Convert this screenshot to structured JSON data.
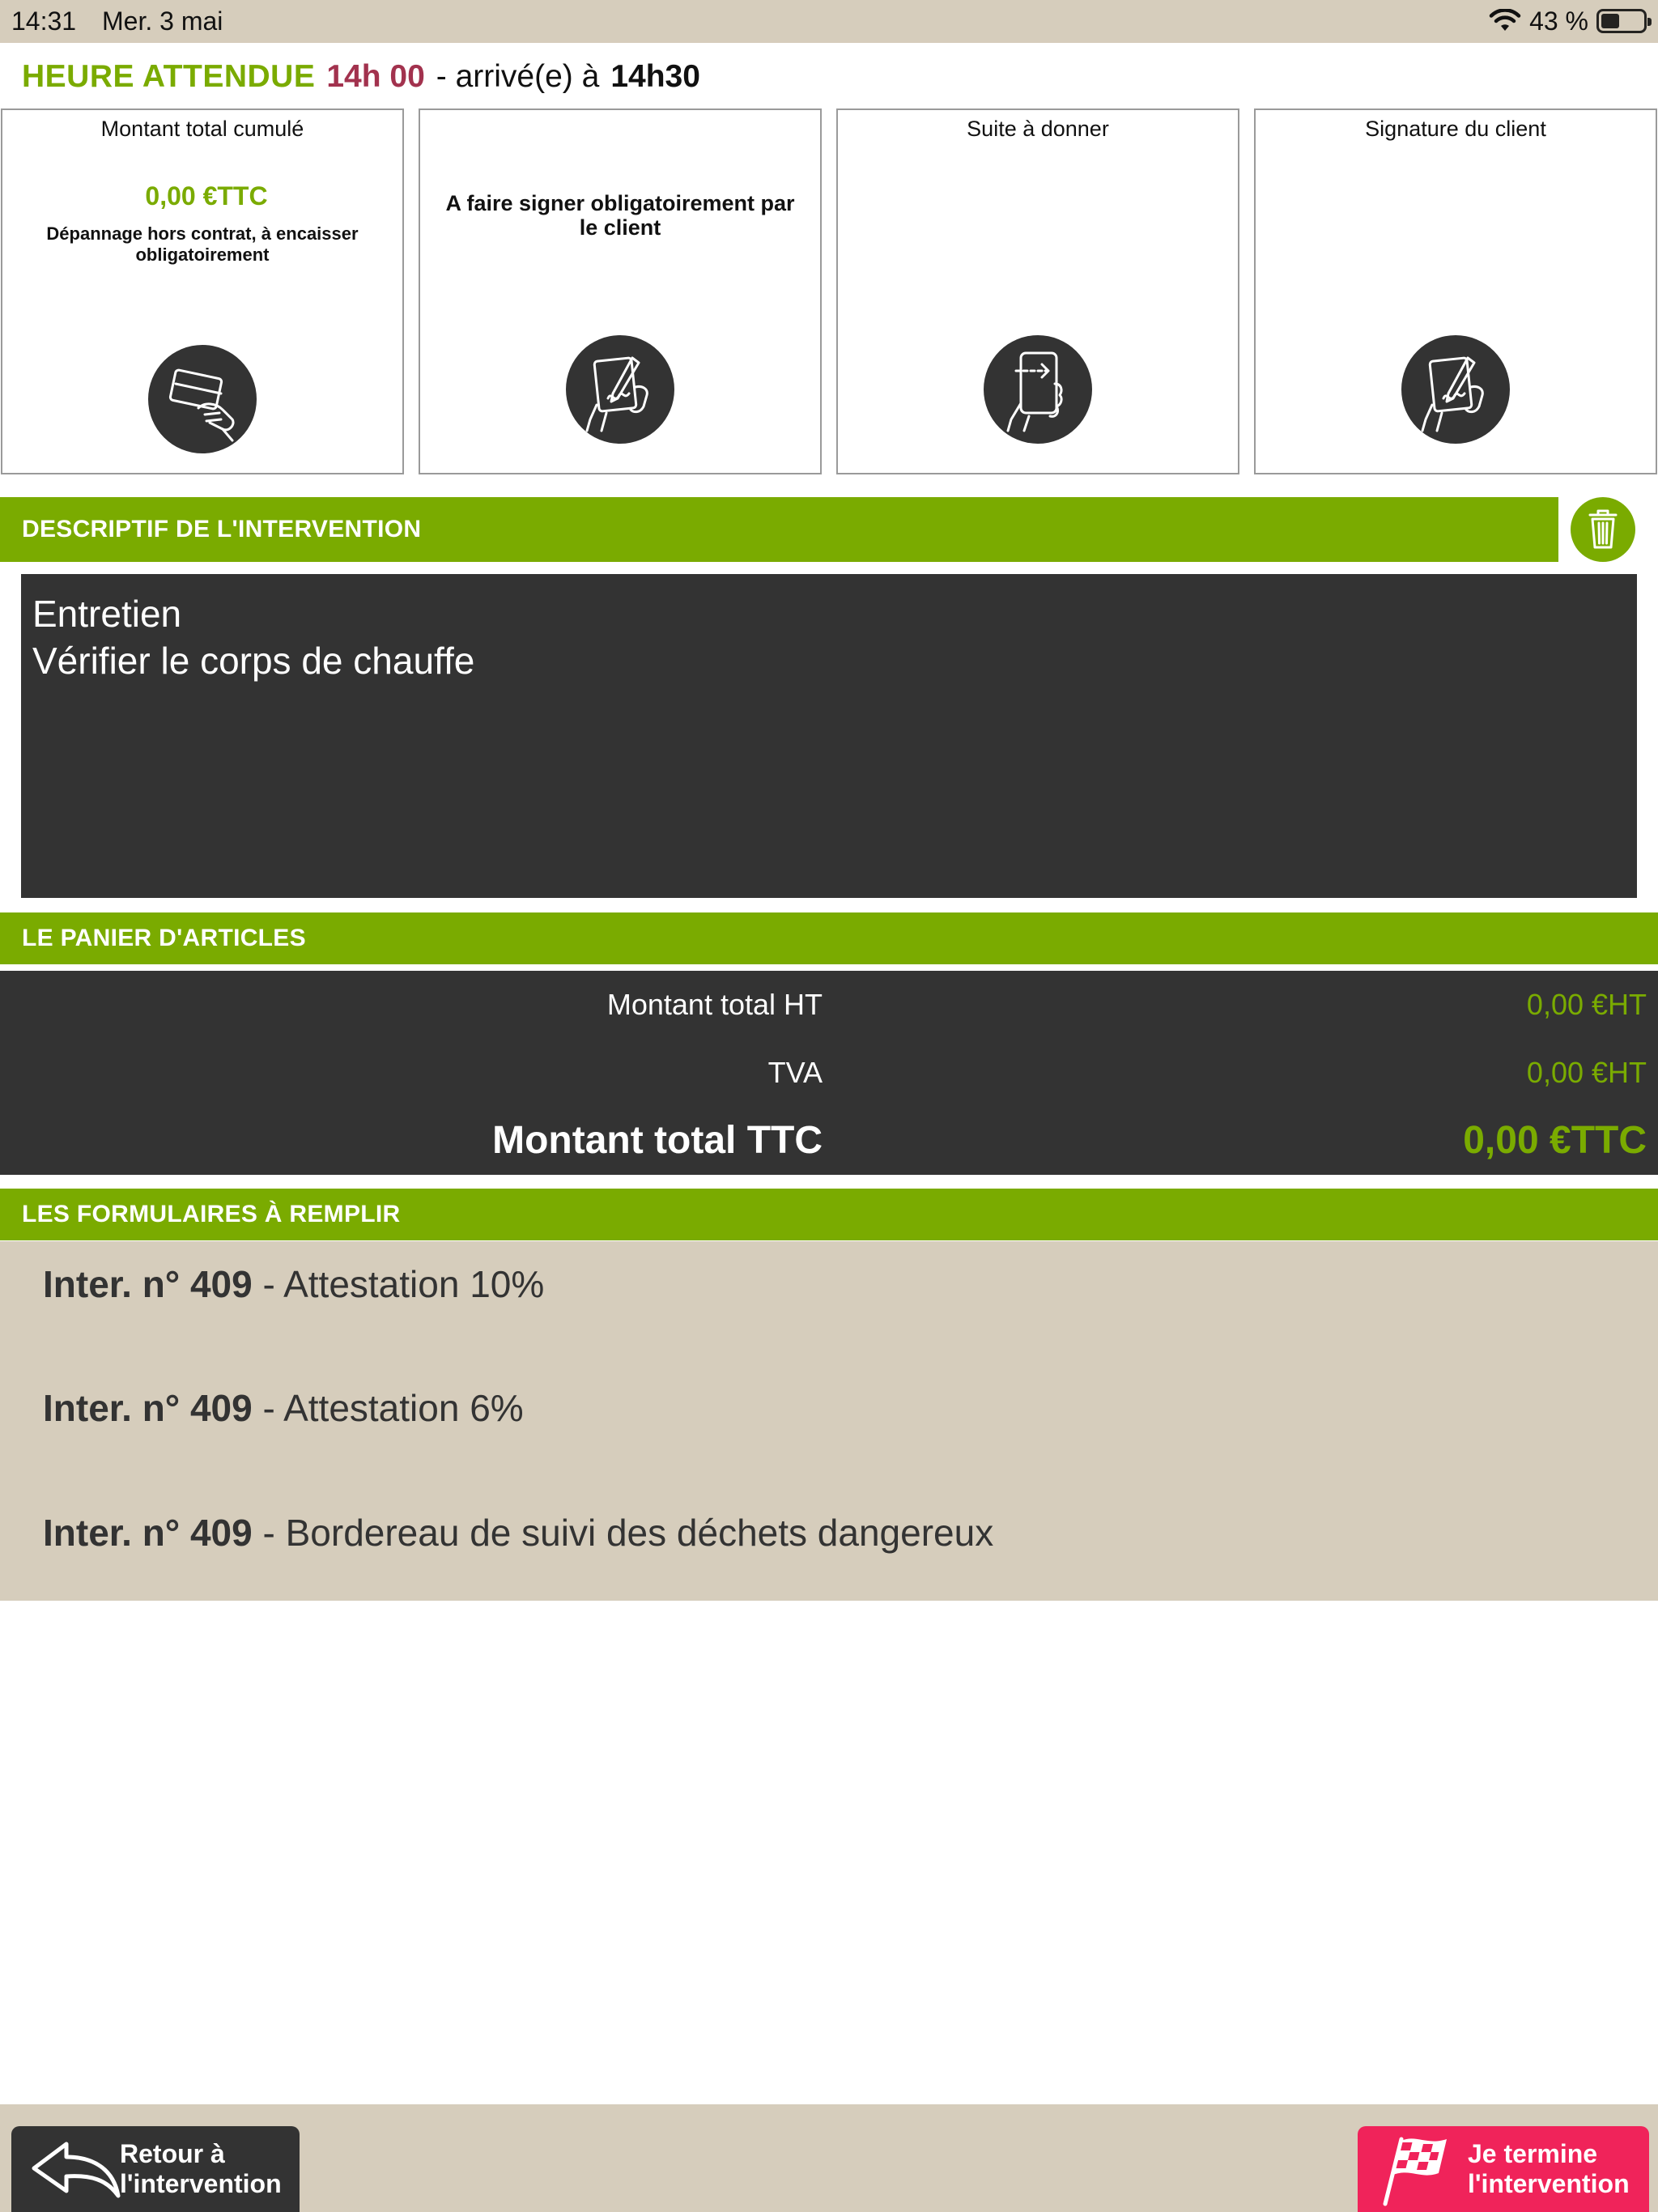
{
  "status_bar": {
    "time": "14:31",
    "date": "Mer. 3 mai",
    "battery": "43 %"
  },
  "heading": {
    "label": "HEURE ATTENDUE",
    "expected_time": "14h 00",
    "separator": "- arrivé(e) à",
    "arrival_time": "14h30"
  },
  "cards": {
    "payment": {
      "title": "Montant total cumulé",
      "amount": "0,00 €TTC",
      "note": "Dépannage hors contrat, à encaisser obligatoirement",
      "icon": "card-payment-icon"
    },
    "sign": {
      "text": "A faire signer obligatoirement par le client",
      "icon": "sign-document-icon"
    },
    "follow_up": {
      "title": "Suite à donner",
      "icon": "phone-share-icon"
    },
    "client_signature": {
      "title": "Signature du client",
      "icon": "sign-document-icon"
    }
  },
  "description": {
    "header": "DESCRIPTIF DE L'INTERVENTION",
    "lines": [
      "Entretien",
      "Vérifier le corps de chauffe"
    ],
    "delete_icon": "trash-icon"
  },
  "basket": {
    "header": "LE PANIER D'ARTICLES",
    "total_ht_label": "Montant total HT",
    "total_ht_value": "0,00 €HT",
    "tva_label": "TVA",
    "tva_value": "0,00 €HT",
    "total_ttc_label": "Montant total TTC",
    "total_ttc_value": "0,00 €TTC"
  },
  "forms": {
    "header": "LES FORMULAIRES À REMPLIR",
    "items": [
      {
        "ref": "Inter. n° 409",
        "name": "- Attestation 10%"
      },
      {
        "ref": "Inter. n° 409",
        "name": "- Attestation 6%"
      },
      {
        "ref": "Inter. n° 409",
        "name": "- Bordereau de suivi des déchets dangereux"
      }
    ]
  },
  "bottom": {
    "back_line1": "Retour à",
    "back_line2": "l'intervention",
    "end_line1": "Je termine",
    "end_line2": "l'intervention"
  },
  "colors": {
    "accent_green": "#7aab00",
    "expected_red": "#a2324e",
    "dark_panel": "#333333",
    "beige": "#d6cdbc",
    "finish_pink": "#f0235a"
  }
}
